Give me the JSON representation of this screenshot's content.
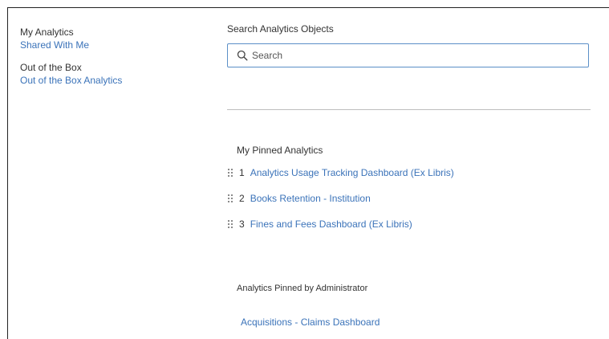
{
  "sidebar": {
    "groups": [
      {
        "title": "My Analytics",
        "link": "Shared With Me"
      },
      {
        "title": "Out of the Box",
        "link": "Out of the Box Analytics"
      }
    ]
  },
  "search": {
    "label": "Search Analytics Objects",
    "placeholder": "Search",
    "value": ""
  },
  "pinned": {
    "title": "My Pinned Analytics",
    "items": [
      {
        "number": "1",
        "label": "Analytics Usage Tracking Dashboard (Ex Libris)"
      },
      {
        "number": "2",
        "label": "Books Retention - Institution"
      },
      {
        "number": "3",
        "label": "Fines and Fees Dashboard (Ex Libris)"
      }
    ]
  },
  "admin_pinned": {
    "title": "Analytics Pinned by Administrator",
    "items": [
      {
        "label": "Acquisitions - Claims Dashboard"
      }
    ]
  },
  "colors": {
    "link": "#3b73b9",
    "text": "#333333",
    "search_border": "#5b8fc7",
    "divider": "#bdbdbd"
  },
  "icons": {
    "search": "search-icon",
    "drag": "drag-handle-icon"
  }
}
